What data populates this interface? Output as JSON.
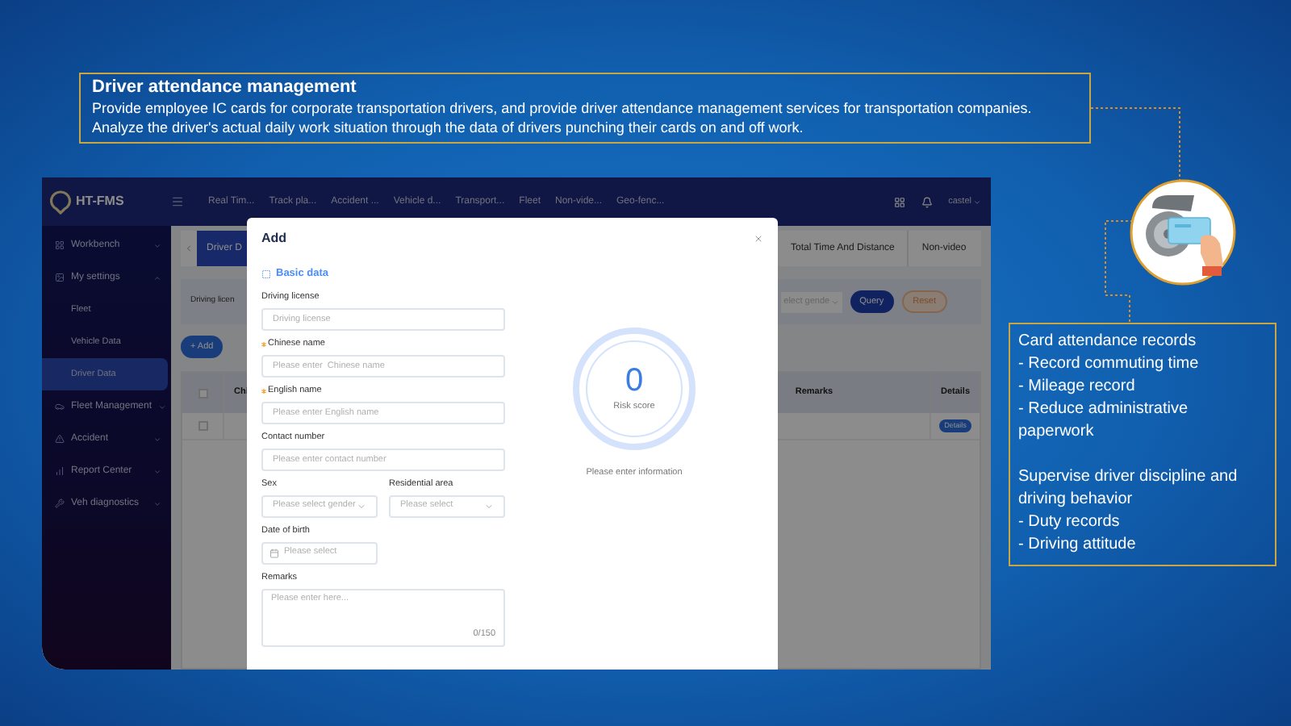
{
  "callout": {
    "title": "Driver attendance management",
    "lines": [
      "Provide employee IC cards for corporate transportation drivers, and provide driver attendance management services for transportation companies.",
      "Analyze the driver's actual daily work situation through the data of drivers punching their cards on and off work."
    ]
  },
  "notes": [
    {
      "heading": "Card attendance records",
      "items": [
        "- Record commuting time",
        "- Mileage record",
        "- Reduce administrative paperwork"
      ]
    },
    {
      "heading": "Supervise driver discipline and driving behavior",
      "items": [
        "- Duty records",
        "- Driving attitude"
      ]
    }
  ],
  "app": {
    "logo": "HT-FMS",
    "nav": [
      "Real Tim...",
      "Track pla...",
      "Accident ...",
      "Vehicle d...",
      "Transport...",
      "Fleet",
      "Non-vide...",
      "Geo-fenc..."
    ],
    "user": "castel",
    "sidebar": [
      {
        "label": "Workbench",
        "expanded": false
      },
      {
        "label": "My settings",
        "expanded": true,
        "children": [
          {
            "label": "Fleet",
            "selected": false
          },
          {
            "label": "Vehicle Data",
            "selected": false
          },
          {
            "label": "Driver Data",
            "selected": true
          }
        ]
      },
      {
        "label": "Fleet Management",
        "expanded": false
      },
      {
        "label": "Accident",
        "expanded": false
      },
      {
        "label": "Report Center",
        "expanded": false
      },
      {
        "label": "Veh diagnostics",
        "expanded": false
      }
    ],
    "tabs": [
      {
        "label": "Driver D",
        "selected": true
      },
      {
        "label": "Total Time And Distance",
        "selected": false
      },
      {
        "label": "Non-video",
        "selected": false
      }
    ],
    "filter": {
      "label": "Driving licen",
      "select_placeholder": "elect gende",
      "query": "Query",
      "reset": "Reset"
    },
    "add_button": "+ Add",
    "table": {
      "select_all": false,
      "columns": [
        "Chi",
        "Remarks",
        "Details"
      ],
      "rows": [
        {
          "checked": false,
          "action": "Details"
        }
      ]
    }
  },
  "modal": {
    "title": "Add",
    "section": "Basic data",
    "rows": [
      [
        {
          "kind": "input",
          "label": "Driving license",
          "required": false,
          "placeholder": "Driving license"
        }
      ],
      [
        {
          "kind": "input",
          "label": "Chinese name",
          "required": true,
          "placeholder": "Please enter  Chinese name"
        }
      ],
      [
        {
          "kind": "input",
          "label": "English name",
          "required": true,
          "placeholder": "Please enter English name"
        }
      ],
      [
        {
          "kind": "input",
          "label": "Contact number",
          "required": false,
          "placeholder": "Please enter contact number"
        }
      ],
      [
        {
          "kind": "select",
          "label": "Sex",
          "required": false,
          "placeholder": "Please select gender"
        },
        {
          "kind": "select",
          "label": "Residential area",
          "required": false,
          "placeholder": "Please select"
        }
      ],
      [
        {
          "kind": "date",
          "label": "Date of birth",
          "required": false,
          "placeholder": "Please select"
        }
      ],
      [
        {
          "kind": "textarea",
          "label": "Remarks",
          "required": false,
          "placeholder": "Please enter here...",
          "counter": "0/150"
        }
      ]
    ],
    "score": {
      "value": "0",
      "label": "Risk score",
      "hint": "Please enter information"
    }
  }
}
